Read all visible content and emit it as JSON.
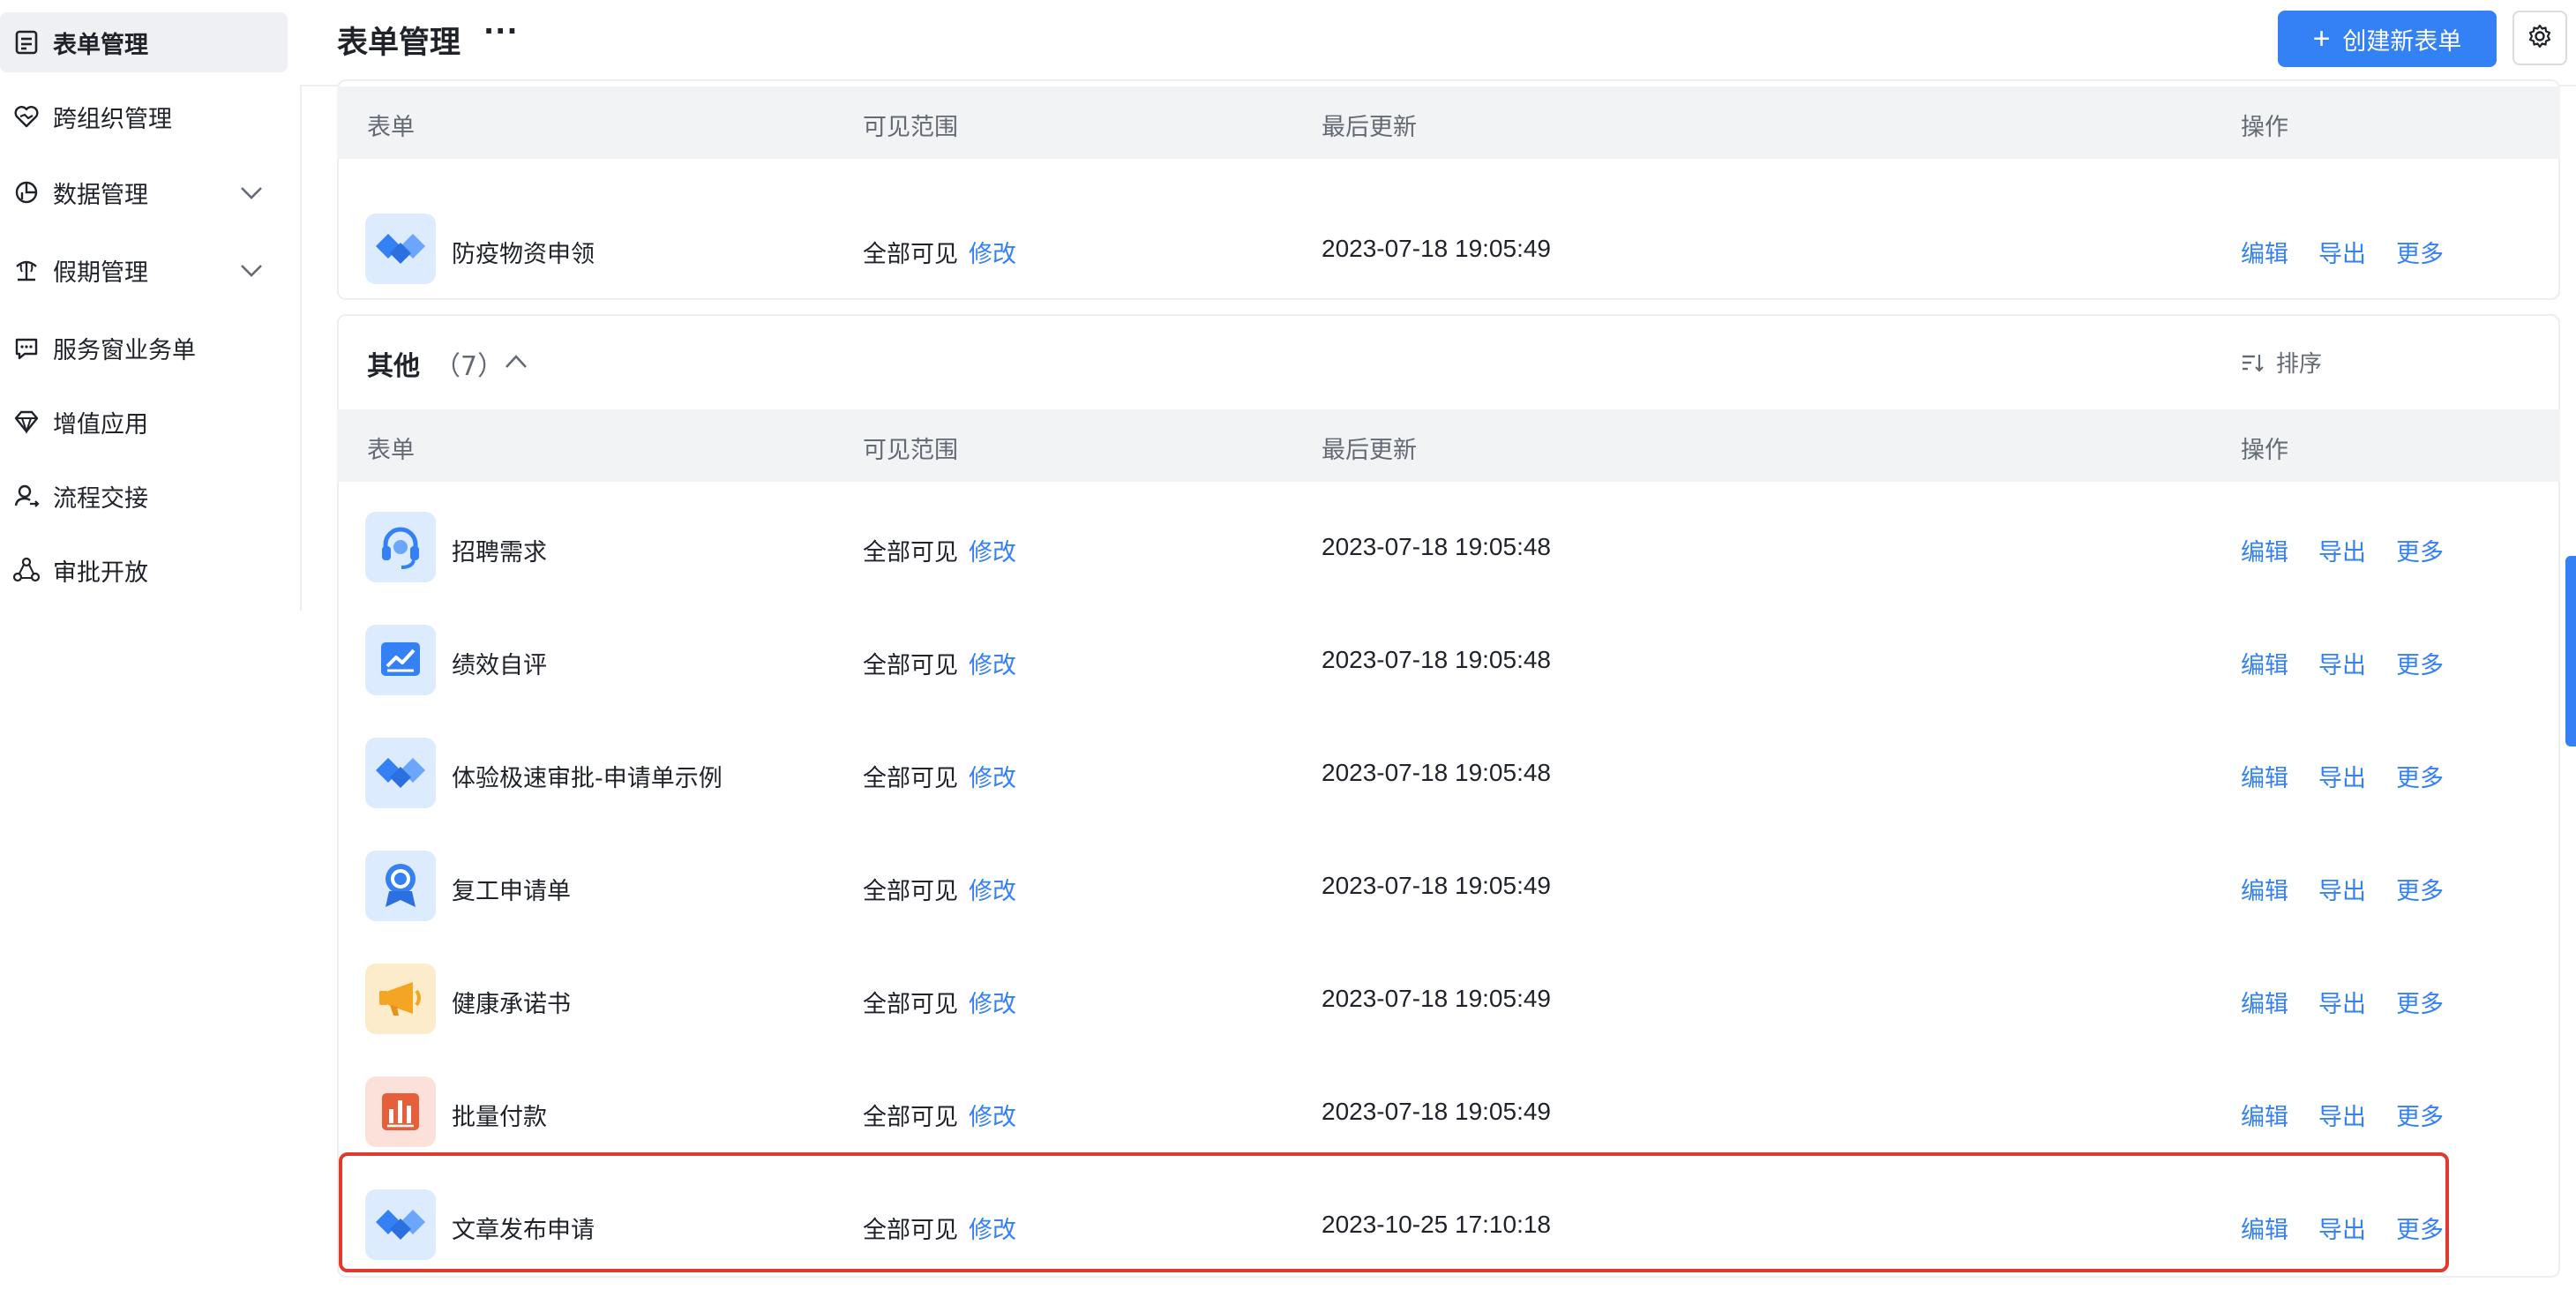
{
  "sidebar": {
    "items": [
      {
        "label": "表单管理",
        "icon": "form-list-icon",
        "active": true
      },
      {
        "label": "跨组织管理",
        "icon": "heart-link-icon"
      },
      {
        "label": "数据管理",
        "icon": "pie-chart-icon",
        "expandable": true
      },
      {
        "label": "假期管理",
        "icon": "palm-tree-icon",
        "expandable": true
      },
      {
        "label": "服务窗业务单",
        "icon": "chat-bubble-icon"
      },
      {
        "label": "增值应用",
        "icon": "diamond-icon"
      },
      {
        "label": "流程交接",
        "icon": "user-handover-icon"
      },
      {
        "label": "审批开放",
        "icon": "network-icon"
      }
    ]
  },
  "header": {
    "title": "表单管理",
    "more_label": "···",
    "create_label": "创建新表单",
    "settings_icon": "gear-icon"
  },
  "table": {
    "columns": [
      "表单",
      "可见范围",
      "最后更新",
      "操作"
    ]
  },
  "top_rows": [
    {
      "name": "防疫物资申领",
      "visibility": "全部可见",
      "visibility_edit": "修改",
      "updated": "2023-07-18 19:05:49",
      "icon": "handshake-icon",
      "icon_bg": "#dcebfd",
      "icon_color": "#3381f5"
    }
  ],
  "section": {
    "title": "其他",
    "count": "（7）",
    "sort_label": "排序"
  },
  "rows": [
    {
      "name": "招聘需求",
      "visibility": "全部可见",
      "visibility_edit": "修改",
      "updated": "2023-07-18 19:05:48",
      "icon": "headset-icon",
      "icon_bg": "#dcebfd",
      "icon_color": "#3381f5"
    },
    {
      "name": "绩效自评",
      "visibility": "全部可见",
      "visibility_edit": "修改",
      "updated": "2023-07-18 19:05:48",
      "icon": "trend-chart-icon",
      "icon_bg": "#dcebfd",
      "icon_color": "#3381f5"
    },
    {
      "name": "体验极速审批-申请单示例",
      "visibility": "全部可见",
      "visibility_edit": "修改",
      "updated": "2023-07-18 19:05:48",
      "icon": "handshake-icon",
      "icon_bg": "#dcebfd",
      "icon_color": "#3381f5"
    },
    {
      "name": "复工申请单",
      "visibility": "全部可见",
      "visibility_edit": "修改",
      "updated": "2023-07-18 19:05:49",
      "icon": "medal-icon",
      "icon_bg": "#dcebfd",
      "icon_color": "#3381f5"
    },
    {
      "name": "健康承诺书",
      "visibility": "全部可见",
      "visibility_edit": "修改",
      "updated": "2023-07-18 19:05:49",
      "icon": "megaphone-icon",
      "icon_bg": "#fdeccb",
      "icon_color": "#f5a524"
    },
    {
      "name": "批量付款",
      "visibility": "全部可见",
      "visibility_edit": "修改",
      "updated": "2023-07-18 19:05:49",
      "icon": "bar-report-icon",
      "icon_bg": "#fbe1d9",
      "icon_color": "#e5603a"
    },
    {
      "name": "文章发布申请",
      "visibility": "全部可见",
      "visibility_edit": "修改",
      "updated": "2023-10-25 17:10:18",
      "icon": "handshake-icon",
      "icon_bg": "#dcebfd",
      "icon_color": "#3381f5",
      "highlighted": true
    }
  ],
  "actions": {
    "edit": "编辑",
    "export": "导出",
    "more": "更多"
  },
  "colors": {
    "accent": "#3381f5",
    "highlight_border": "#e0392d",
    "header_bg": "#f2f3f5"
  }
}
